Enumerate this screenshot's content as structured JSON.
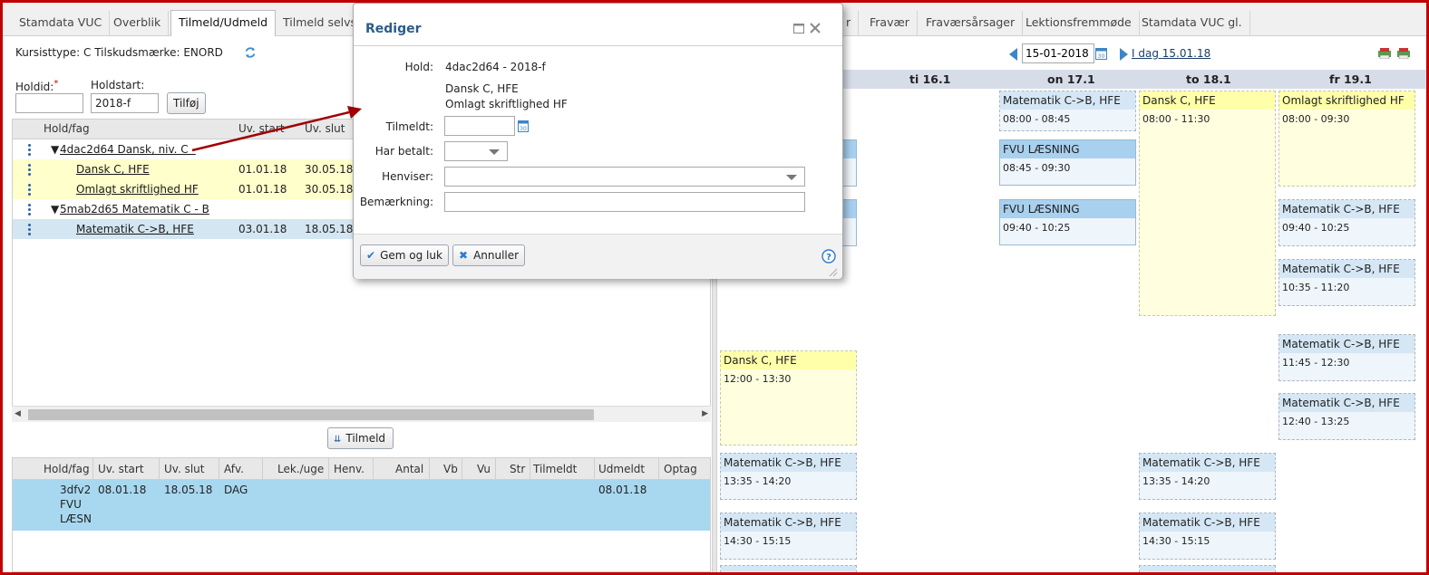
{
  "tabs": [
    {
      "label": "Stamdata VUC"
    },
    {
      "label": "Overblik"
    },
    {
      "label": "Tilmeld/Udmeld"
    },
    {
      "label": "Tilmeld selvs"
    },
    {
      "label": "r"
    },
    {
      "label": "Fravær"
    },
    {
      "label": "Fraværsårsager"
    },
    {
      "label": "Lektionsfremmøde"
    },
    {
      "label": "Stamdata VUC gl."
    }
  ],
  "kursist": {
    "info": "Kursisttype:  C  Tilskudsmærke: ENORD"
  },
  "form": {
    "holdid_label": "Holdid:",
    "required_mark": "*",
    "holdid_value": "",
    "holdstart_label": "Holdstart:",
    "holdstart_value": "2018-f",
    "add_button": "Tilføj"
  },
  "top_grid": {
    "headers": [
      "Hold/fag",
      "Uv. start",
      "Uv. slut"
    ],
    "rows": [
      {
        "name": "4dac2d64 Dansk, niv. C -",
        "start": "",
        "slut": ""
      },
      {
        "name": "Dansk C, HFE",
        "start": "01.01.18",
        "slut": "30.05.18"
      },
      {
        "name": "Omlagt skriftlighed HF",
        "start": "01.01.18",
        "slut": "30.05.18"
      },
      {
        "name": "5mab2d65 Matematik C - B",
        "start": "",
        "slut": ""
      },
      {
        "name": "Matematik C->B, HFE",
        "start": "03.01.18",
        "slut": "18.05.18"
      }
    ]
  },
  "tilmeld_button": "Tilmeld",
  "bottom_grid": {
    "headers": [
      "Hold/fag",
      "Uv. start",
      "Uv. slut",
      "Afv.",
      "Lek./uge",
      "Henv.",
      "Antal",
      "Vb",
      "Vu",
      "Str",
      "Tilmeldt",
      "Udmeldt",
      "Optag"
    ],
    "row": {
      "hold_line1": "3dfv2",
      "hold_line2": "FVU",
      "hold_line3": "LÆSN",
      "start": "08.01.18",
      "slut": "18.05.18",
      "afv": "DAG",
      "udmeldt": "08.01.18"
    }
  },
  "calendar": {
    "date_value": "15-01-2018",
    "today_label": "I dag",
    "today_date": "15.01.18",
    "days": [
      "ti 16.1",
      "on 17.1",
      "to 18.1",
      "fr 19.1"
    ],
    "events": [
      {
        "title": "Matematik C->B, HFE",
        "time": "08:00 - 08:45"
      },
      {
        "title": "FVU LÆSNING",
        "time": "08:45 - 09:30"
      },
      {
        "title": "FVU LÆSNING",
        "time": "09:40 - 10:25"
      },
      {
        "title": "Dansk C, HFE",
        "time": "08:00 - 11:30"
      },
      {
        "title": "Omlagt skriftlighed HF",
        "time": "08:00 - 09:30"
      },
      {
        "title": "Matematik C->B, HFE",
        "time": "09:40 - 10:25"
      },
      {
        "title": "Matematik C->B, HFE",
        "time": "10:35 - 11:20"
      },
      {
        "title": "Matematik C->B, HFE",
        "time": "11:45 - 12:30"
      },
      {
        "title": "Matematik C->B, HFE",
        "time": "12:40 - 13:25"
      },
      {
        "title": "Dansk C, HFE",
        "time": "12:00 - 13:30"
      },
      {
        "title": "Matematik C->B, HFE",
        "time": "13:35 - 14:20"
      },
      {
        "title": "Matematik C->B, HFE",
        "time": "13:35 - 14:20"
      },
      {
        "title": "Matematik C->B, HFE",
        "time": "14:30 - 15:15"
      },
      {
        "title": "Matematik C->B, HFE",
        "time": "14:30 - 15:15"
      }
    ]
  },
  "dialog": {
    "title": "Rediger",
    "hold_label": "Hold:",
    "hold_value": "4dac2d64 - 2018-f",
    "fag_line1": "Dansk C, HFE",
    "fag_line2": "Omlagt skriftlighed HF",
    "tilmeldt_label": "Tilmeldt:",
    "tilmeldt_value": "",
    "betalt_label": "Har betalt:",
    "henviser_label": "Henviser:",
    "bemaerkning_label": "Bemærkning:",
    "bemaerkning_value": "",
    "save_button": "Gem og luk",
    "cancel_button": "Annuller"
  },
  "colors": {
    "accent": "#2b5c8a",
    "frame": "#c00000",
    "arrow": "#a00000",
    "row_yellow": "#ffffcc",
    "row_blue": "#a8d8f0"
  }
}
